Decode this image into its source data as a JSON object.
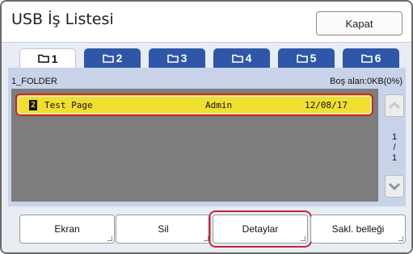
{
  "window": {
    "title": "USB İş Listesi",
    "close_label": "Kapat"
  },
  "tabs": [
    {
      "label": "1",
      "icon": "folder-icon",
      "active": true
    },
    {
      "label": "2",
      "icon": "folder-icon",
      "active": false
    },
    {
      "label": "3",
      "icon": "folder-icon",
      "active": false
    },
    {
      "label": "4",
      "icon": "folder-icon",
      "active": false
    },
    {
      "label": "5",
      "icon": "folder-icon",
      "active": false
    },
    {
      "label": "6",
      "icon": "folder-icon",
      "active": false
    }
  ],
  "folder": {
    "name": "1_FOLDER",
    "free_space": "Boş alan:0KB(0%)"
  },
  "jobs": [
    {
      "number": "2",
      "name": "Test Page",
      "user": "Admin",
      "date": "12/08/17",
      "selected": true
    }
  ],
  "pagination": {
    "current": "1",
    "separator": "/",
    "total": "1"
  },
  "actions": {
    "screen": "Ekran",
    "delete": "Sil",
    "details": "Detaylar",
    "save_memory": "Sakl. belleği"
  },
  "colors": {
    "tab_blue": "#2f57a8",
    "selected_row": "#f0df2e",
    "highlight_red": "#c4263a"
  }
}
